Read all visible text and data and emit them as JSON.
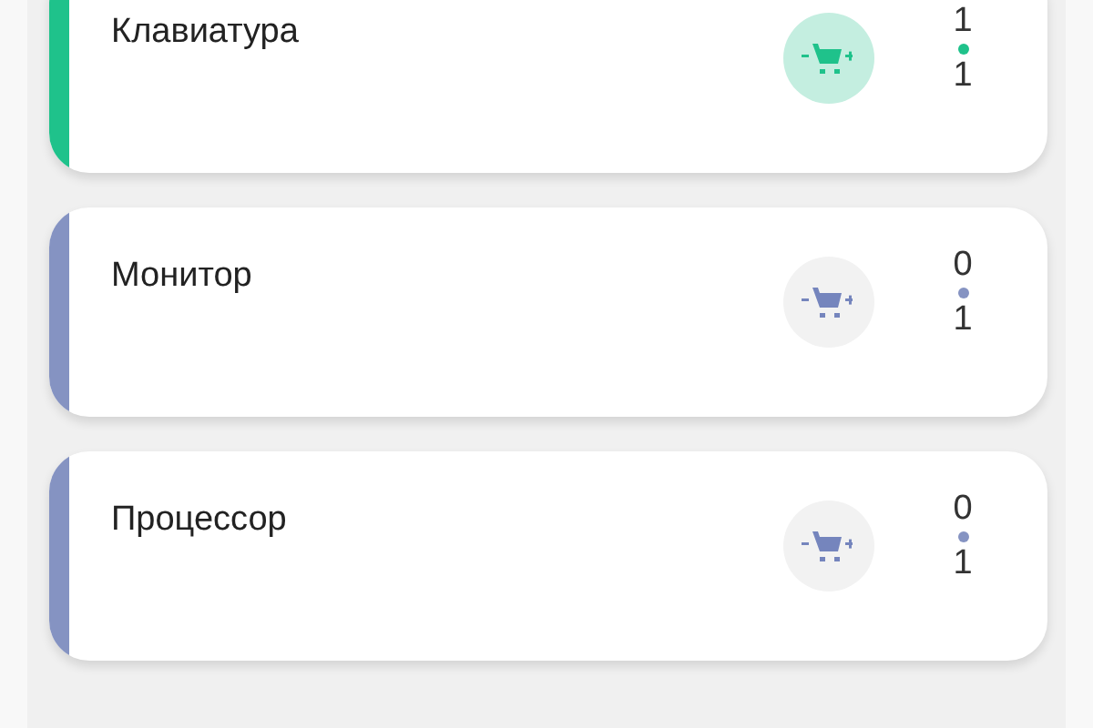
{
  "products": [
    {
      "name": "Клавиатура",
      "color": "#1fc28b",
      "selected": true,
      "count": "1",
      "total": "1"
    },
    {
      "name": "Монитор",
      "color": "#8593c2",
      "selected": false,
      "count": "0",
      "total": "1"
    },
    {
      "name": "Процессор",
      "color": "#8593c2",
      "selected": false,
      "count": "0",
      "total": "1"
    }
  ]
}
